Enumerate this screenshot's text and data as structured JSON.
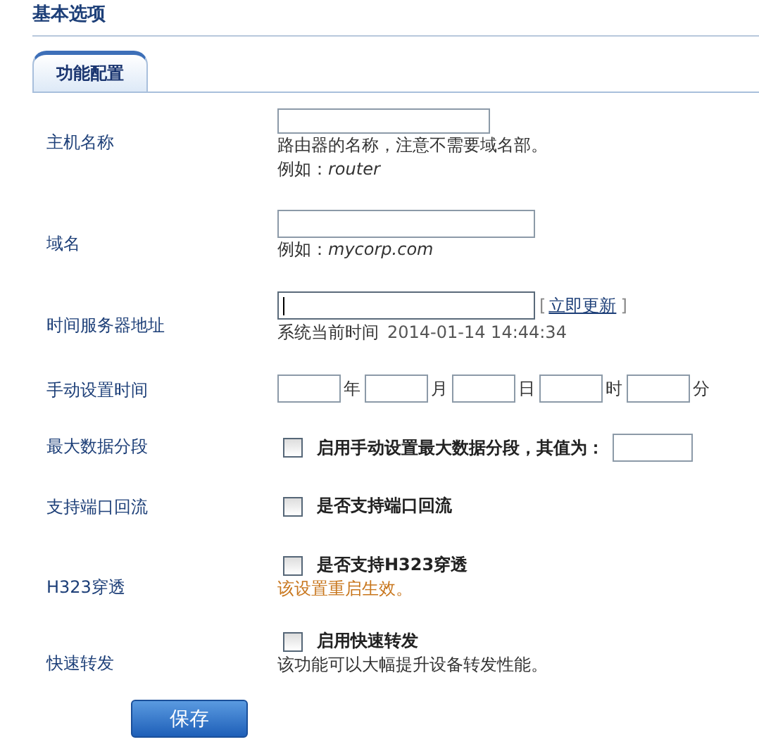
{
  "title": "基本选项",
  "tabs": [
    {
      "label": "功能配置",
      "selected": true
    }
  ],
  "rows": [
    {
      "kind": "text",
      "label": "主机名称",
      "hint": "路由器的名称，注意不需要域名部。",
      "example": "例如：*router*"
    },
    {
      "kind": "text",
      "label": "域名",
      "example": "例如：*mycorp.com*"
    },
    {
      "kind": "server",
      "label": "时间服务器地址",
      "focused": true,
      "link_open": "[",
      "link": "立即更新",
      "link_close": "]",
      "status_label": "系统当前时间",
      "status_value": "2014-01-14 14:44:34"
    },
    {
      "kind": "datetime",
      "label": "手动设置时间",
      "units": [
        "年",
        "月",
        "日",
        "时",
        "分"
      ]
    },
    {
      "kind": "checkbox_field",
      "label": "最大数据分段",
      "text": "启用手动设置最大数据分段，其值为：",
      "checked": false
    },
    {
      "kind": "checkbox",
      "label": "支持端口回流",
      "text": "是否支持端口回流",
      "checked": false
    },
    {
      "kind": "checkbox",
      "label": "H323穿透",
      "text": "是否支持H323穿透",
      "checked": false,
      "note": "该设置重启生效。",
      "warning": true
    },
    {
      "kind": "checkbox",
      "label": "快速转发",
      "text": "启用快速转发",
      "checked": false,
      "note": "该功能可以大幅提升设备转发性能。",
      "warning": false
    }
  ],
  "save_button": "保存"
}
